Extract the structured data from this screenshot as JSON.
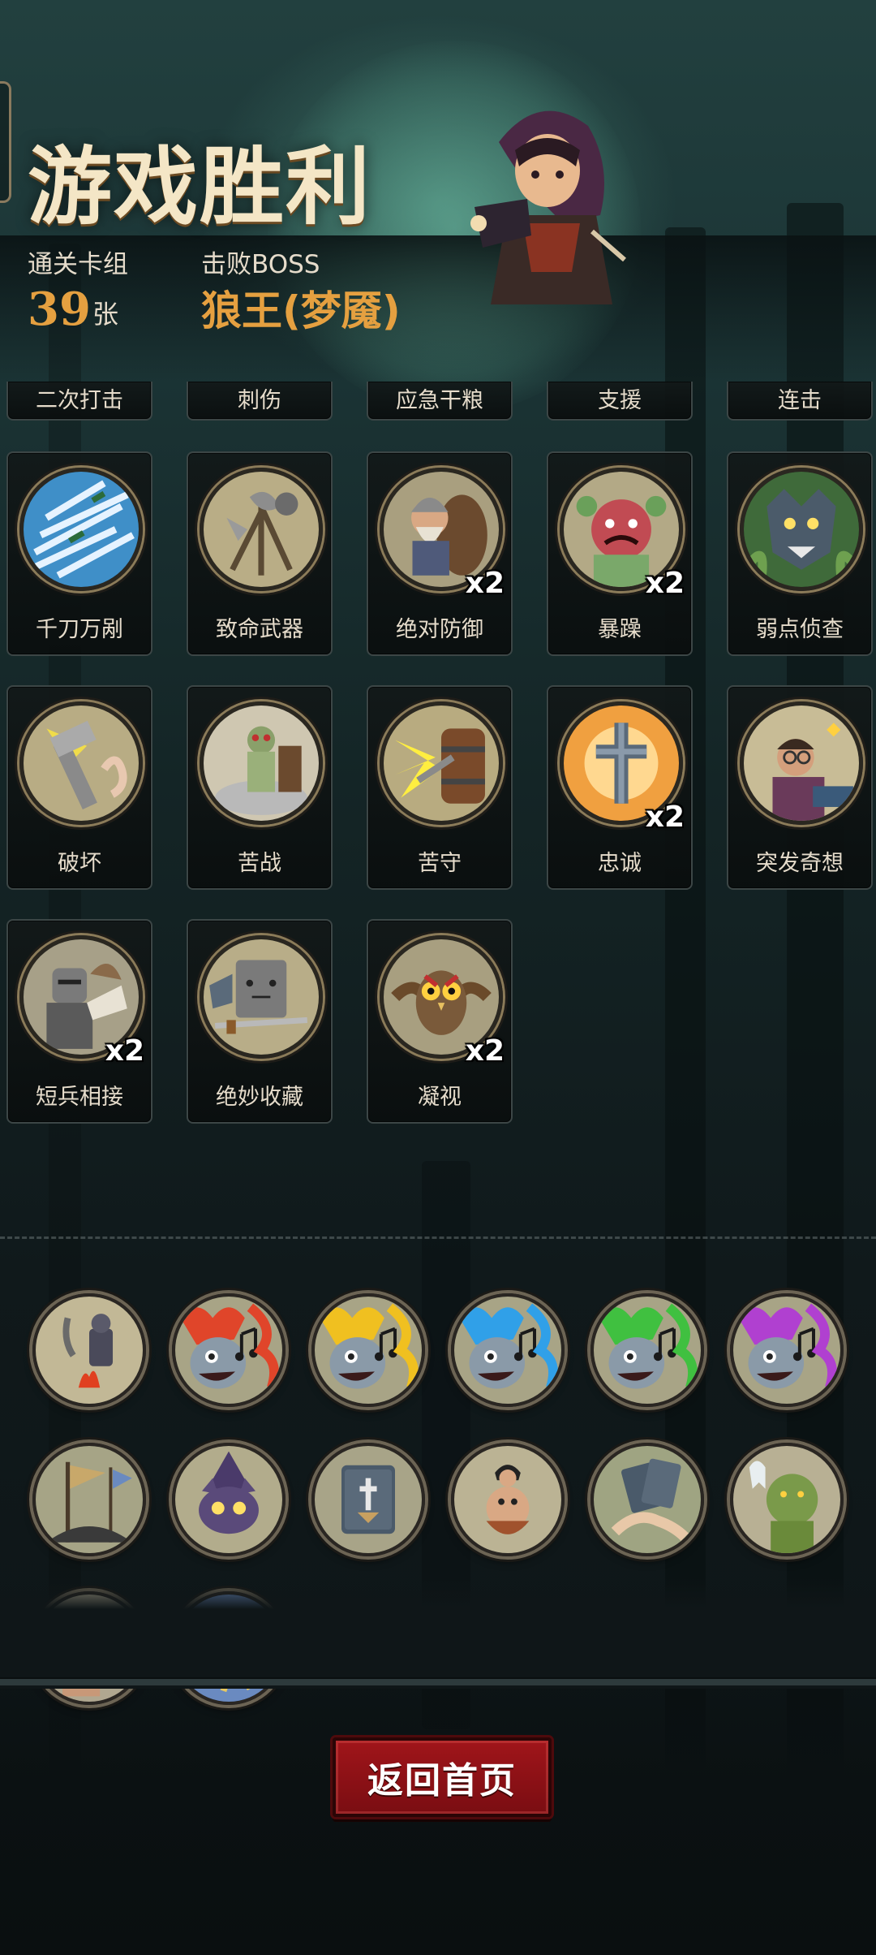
{
  "header": {
    "title": "游戏胜利",
    "deck_label": "通关卡组",
    "deck_count": "39",
    "deck_unit": "张",
    "boss_label": "击败BOSS",
    "boss_name": "狼王(梦魇)"
  },
  "top_row_cards": [
    "二次打击",
    "刺伤",
    "应急干粮",
    "支援",
    "连击"
  ],
  "cards": [
    {
      "label": "千刀万剐",
      "icon": "blades-icon",
      "badge": ""
    },
    {
      "label": "致命武器",
      "icon": "weapons-icon",
      "badge": ""
    },
    {
      "label": "绝对防御",
      "icon": "dwarf-shield-icon",
      "badge": "x2"
    },
    {
      "label": "暴躁",
      "icon": "angry-ogre-icon",
      "badge": "x2"
    },
    {
      "label": "弱点侦查",
      "icon": "wolf-icon",
      "badge": ""
    },
    {
      "label": "破坏",
      "icon": "hammer-icon",
      "badge": ""
    },
    {
      "label": "苦战",
      "icon": "mummy-icon",
      "badge": ""
    },
    {
      "label": "苦守",
      "icon": "barrel-shield-icon",
      "badge": ""
    },
    {
      "label": "忠诚",
      "icon": "cross-icon",
      "badge": "x2"
    },
    {
      "label": "突发奇想",
      "icon": "scholar-icon",
      "badge": ""
    },
    {
      "label": "短兵相接",
      "icon": "knight-icon",
      "badge": "x2"
    },
    {
      "label": "绝妙收藏",
      "icon": "book-sword-icon",
      "badge": ""
    },
    {
      "label": "凝视",
      "icon": "owl-icon",
      "badge": "x2"
    }
  ],
  "relics": [
    {
      "icon": "campfire-knight-icon"
    },
    {
      "icon": "red-ghost-music-icon"
    },
    {
      "icon": "yellow-ghost-music-icon"
    },
    {
      "icon": "blue-ghost-music-icon"
    },
    {
      "icon": "green-ghost-music-icon"
    },
    {
      "icon": "purple-ghost-music-icon"
    },
    {
      "icon": "battle-banner-icon"
    },
    {
      "icon": "witch-cat-icon"
    },
    {
      "icon": "spellbook-icon"
    },
    {
      "icon": "pirate-crew-icon"
    },
    {
      "icon": "card-hand-icon"
    },
    {
      "icon": "ghost-ogre-icon"
    },
    {
      "icon": "bloody-brawler-icon"
    },
    {
      "icon": "caped-hero-icon"
    }
  ],
  "buttons": {
    "home": "返回首页"
  },
  "colors": {
    "accent_gold": "#e5a040",
    "title_cream": "#f4e6c6",
    "button_red": "#a0151a"
  }
}
